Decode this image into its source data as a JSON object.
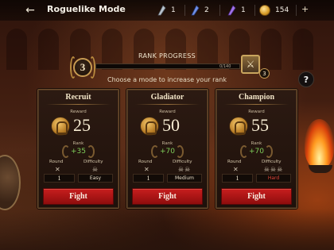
{
  "header": {
    "back_icon": "back-arrow-icon",
    "title": "Roguelike Mode",
    "currencies": [
      {
        "name": "silver-crystal",
        "value": "1",
        "color": "#b9c3cc"
      },
      {
        "name": "blue-crystal",
        "value": "2",
        "color": "#6f8fe6"
      },
      {
        "name": "purple-crystal",
        "value": "1",
        "color": "#a173e8"
      },
      {
        "name": "gold-coin",
        "value": "154",
        "color": "#e1a632"
      }
    ],
    "add_label": "+"
  },
  "rank_progress": {
    "current_rank": "3",
    "title": "RANK PROGRESS",
    "progress_text": "0/140",
    "progress": 0.0,
    "reward_rank": "3",
    "subtitle": "Choose a mode to increase your rank",
    "help_label": "?"
  },
  "modes": [
    {
      "title": "Recruit",
      "reward_label": "Reward",
      "reward": "25",
      "rank_label": "Rank",
      "rank_gain": "+35",
      "round_label": "Round",
      "difficulty_label": "Difficulty",
      "round": "1",
      "difficulty": "Easy",
      "skulls": 1,
      "fight_label": "Fight"
    },
    {
      "title": "Gladiator",
      "reward_label": "Reward",
      "reward": "50",
      "rank_label": "Rank",
      "rank_gain": "+70",
      "round_label": "Round",
      "difficulty_label": "Difficulty",
      "round": "1",
      "difficulty": "Medium",
      "skulls": 2,
      "fight_label": "Fight"
    },
    {
      "title": "Champion",
      "reward_label": "Reward",
      "reward": "55",
      "rank_label": "Rank",
      "rank_gain": "+70",
      "round_label": "Round",
      "difficulty_label": "Difficulty",
      "round": "1",
      "difficulty": "Hard",
      "skulls": 3,
      "fight_label": "Fight"
    }
  ],
  "colors": {
    "fight_button": "#b31616",
    "rank_gain": "#7fcf5a",
    "hard": "#e3473a",
    "accent_gold": "#c79a52"
  }
}
